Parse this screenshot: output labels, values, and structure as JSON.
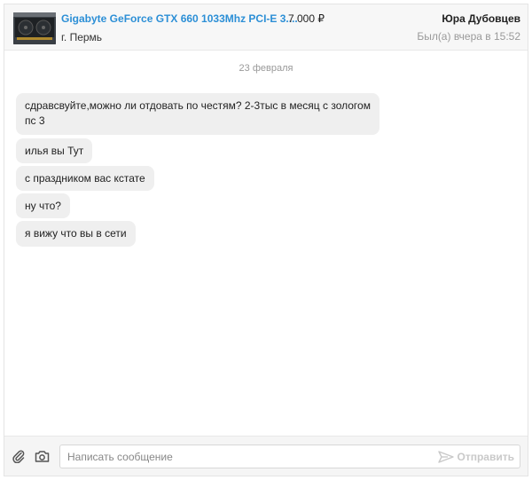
{
  "header": {
    "item_title": "Gigabyte GeForce GTX 660 1033Mhz PCI-E 3....",
    "price": "7 000 ₽",
    "city": "г. Пермь",
    "user_name": "Юра Дубовцев",
    "user_status": "Был(а) вчера в 15:52"
  },
  "messages": {
    "date": "23 февраля",
    "items": [
      {
        "line1": "сдравсвуйте,можно ли отдовать по честям? 2-3тыс в месяц с зологом",
        "line2": "пс 3"
      },
      {
        "text": "илья вы Тут"
      },
      {
        "text": "с праздником вас кстате"
      },
      {
        "text": "ну что?"
      },
      {
        "text": "я вижу что вы в сети"
      }
    ]
  },
  "composer": {
    "placeholder": "Написать сообщение",
    "send_label": "Отправить"
  },
  "icons": {
    "attach": "paperclip-icon",
    "camera": "camera-icon",
    "send": "send-icon"
  }
}
